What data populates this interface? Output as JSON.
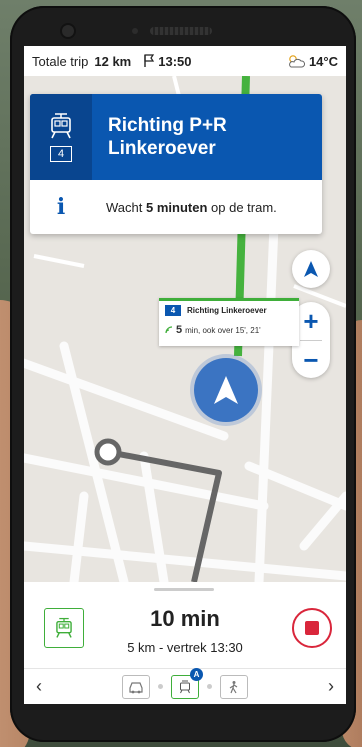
{
  "status": {
    "trip_label": "Totale trip",
    "trip_distance": "12 km",
    "arrival_time": "13:50",
    "temperature": "14°C"
  },
  "direction": {
    "title": "Richting P+R Linkeroever",
    "line_number": "4",
    "wait_prefix": "Wacht",
    "wait_bold": "5 minuten",
    "wait_suffix": "op de tram."
  },
  "tooltip": {
    "line_number": "4",
    "title": "Richting Linkeroever",
    "minutes": "5",
    "detail": "min, ook over 15', 21'"
  },
  "trip_summary": {
    "duration": "10 min",
    "subtitle": "5 km - vertrek 13:30"
  },
  "mode_bar": {
    "badge": "A",
    "prev_label": "‹",
    "next_label": "›"
  },
  "colors": {
    "brand_blue": "#0a57b0",
    "tram_green": "#3fae3a",
    "stop_red": "#d9263b"
  },
  "icons": {
    "map_layer": "navigation-arrow-icon",
    "tram": "tram-icon",
    "info": "info-icon",
    "stop": "stop-icon"
  }
}
